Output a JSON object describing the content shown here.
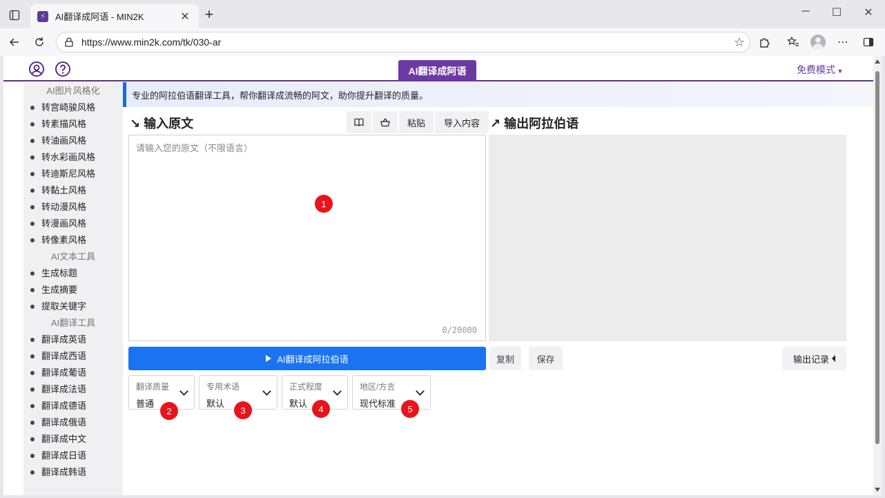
{
  "browser": {
    "tab_title": "AI翻译成阿语 - MIN2K",
    "url": "https://www.min2k.com/tk/030-ar"
  },
  "topnav": {
    "center_tab": "AI翻译成阿语",
    "free_mode": "免费模式"
  },
  "sidebar": {
    "groups": [
      {
        "title": "AI图片风格化",
        "items": [
          "转宫崎骏风格",
          "转素描风格",
          "转油画风格",
          "转水彩画风格",
          "转迪斯尼风格",
          "转黏土风格",
          "转动漫风格",
          "转漫画风格",
          "转像素风格"
        ]
      },
      {
        "title": "AI文本工具",
        "items": [
          "生成标题",
          "生成摘要",
          "提取关键字"
        ]
      },
      {
        "title": "AI翻译工具",
        "items": [
          "翻译成英语",
          "翻译成西语",
          "翻译成葡语",
          "翻译成法语",
          "翻译成德语",
          "翻译成俄语",
          "翻译成中文",
          "翻译成日语",
          "翻译成韩语"
        ]
      }
    ]
  },
  "notice": "专业的阿拉伯语翻译工具，帮你翻译成流畅的阿文，助你提升翻译的质量。",
  "input_section": {
    "title": "输入原文",
    "placeholder": "请输入您的原文（不限语言）",
    "counter": "0/20000",
    "paste_label": "粘贴",
    "import_label": "导入内容"
  },
  "output_section": {
    "title": "输出阿拉伯语"
  },
  "actions": {
    "translate": "AI翻译成阿拉伯语",
    "copy": "复制",
    "save": "保存",
    "history": "输出记录"
  },
  "options": [
    {
      "label": "翻译质量",
      "value": "普通"
    },
    {
      "label": "专用术语",
      "value": "默认"
    },
    {
      "label": "正式程度",
      "value": "默认"
    },
    {
      "label": "地区/方言",
      "value": "现代标准"
    }
  ],
  "markers": [
    "1",
    "2",
    "3",
    "4",
    "5"
  ],
  "colors": {
    "brand_purple": "#6a3aa2",
    "primary_blue": "#1a73f0",
    "marker_red": "#e8141b"
  }
}
